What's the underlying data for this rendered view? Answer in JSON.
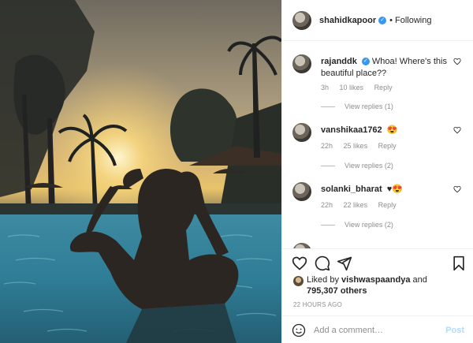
{
  "header": {
    "username": "shahidkapoor",
    "verified_mark": "✓",
    "separator": "•",
    "follow_status": "Following"
  },
  "comments": [
    {
      "username": "rajanddk",
      "verified": true,
      "text": "Whoa! Where's this beautiful place??",
      "time": "3h",
      "likes": "10 likes",
      "reply": "Reply",
      "view_replies": "View replies (1)"
    },
    {
      "username": "vanshikaa1762",
      "verified": false,
      "text": "😍",
      "time": "22h",
      "likes": "25 likes",
      "reply": "Reply",
      "view_replies": "View replies (2)"
    },
    {
      "username": "solanki_bharat",
      "verified": false,
      "text": "♥😍",
      "time": "22h",
      "likes": "22 likes",
      "reply": "Reply",
      "view_replies": "View replies (2)"
    }
  ],
  "likes": {
    "prefix": "Liked by ",
    "liked_by_user": "vishwaspaandya",
    "and": " and",
    "others_count": "795,307 others"
  },
  "timestamp": "22 HOURS AGO",
  "add_comment": {
    "placeholder": "Add a comment…",
    "post_label": "Post"
  },
  "colors": {
    "verified_blue": "#3897f0",
    "muted_text": "#8e8e8e",
    "post_disabled": "#b3dbff"
  },
  "icons": {
    "like": "heart-icon",
    "comment": "comment-icon",
    "share": "paper-plane-icon",
    "save": "bookmark-icon",
    "emoji": "smiley-icon"
  }
}
